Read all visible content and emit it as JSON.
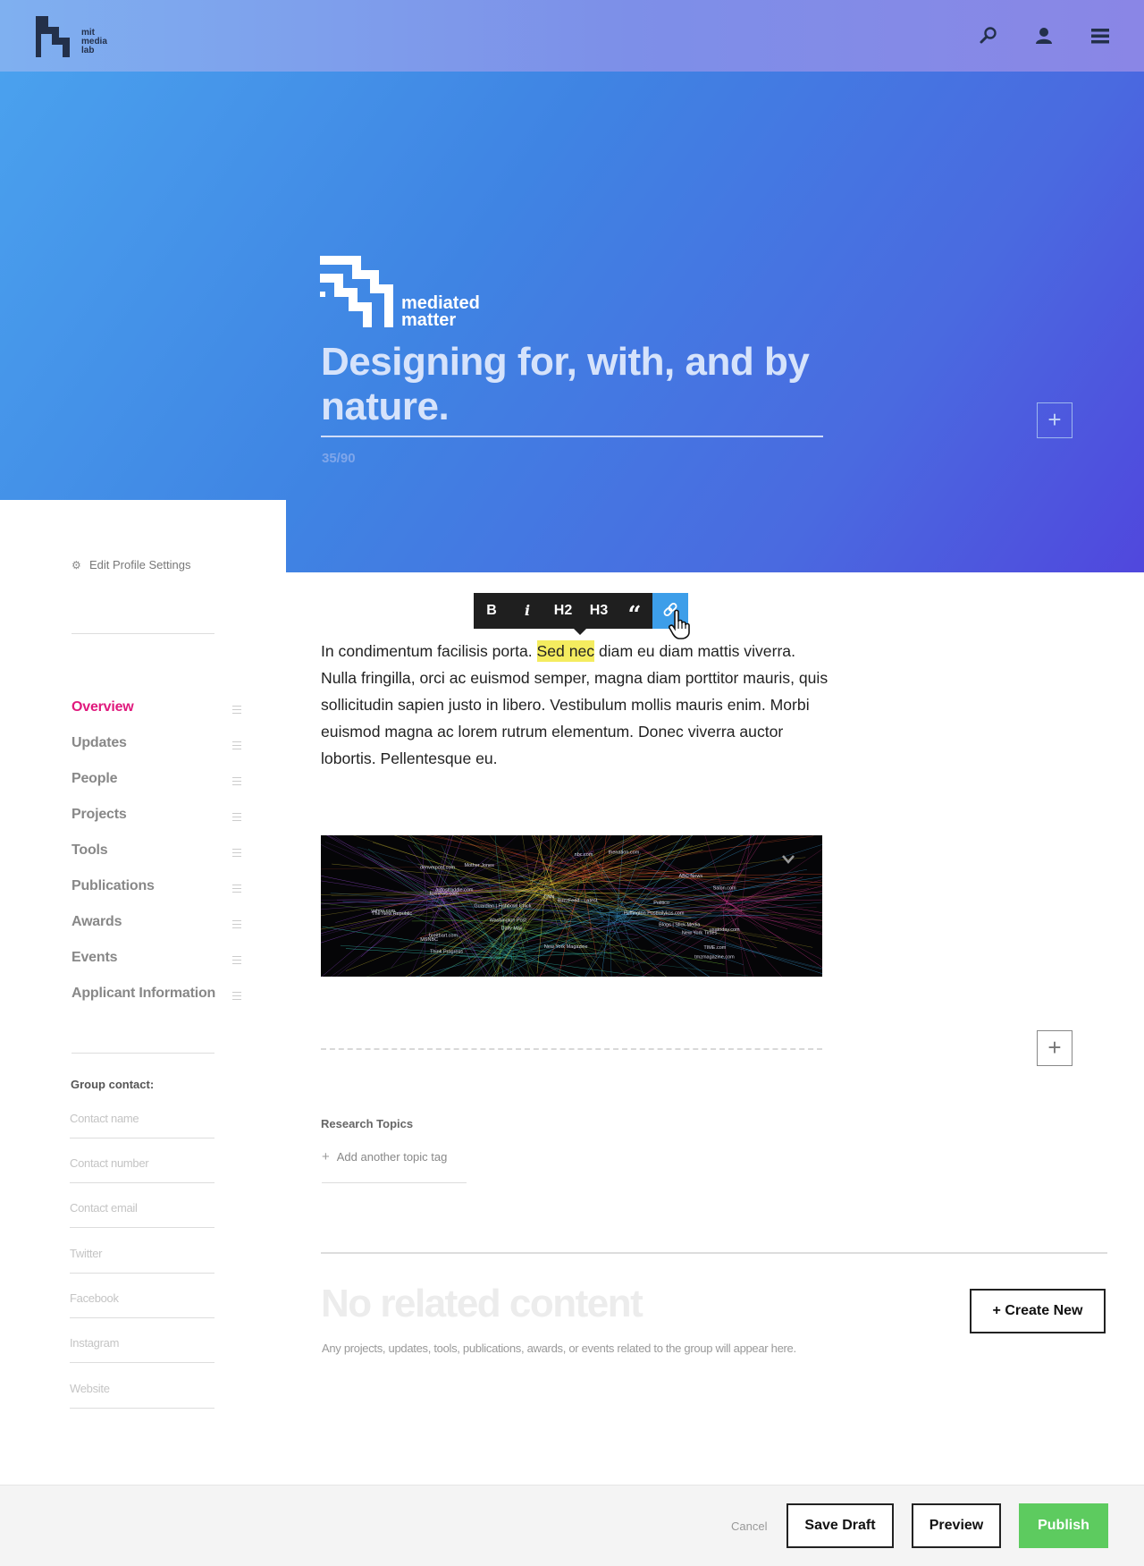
{
  "header": {
    "logo_text": [
      "mit",
      "media",
      "lab"
    ],
    "icons": [
      "search-icon",
      "user-icon",
      "menu-icon"
    ]
  },
  "hero": {
    "group_logo_text": [
      "mediated",
      "matter"
    ],
    "title": "Designing for, with, and by nature.",
    "char_count": "35/90"
  },
  "sidebar": {
    "edit_profile_label": "Edit Profile Settings",
    "nav": [
      {
        "label": "Overview",
        "active": true
      },
      {
        "label": "Updates"
      },
      {
        "label": "People"
      },
      {
        "label": "Projects"
      },
      {
        "label": "Tools"
      },
      {
        "label": "Publications"
      },
      {
        "label": "Awards"
      },
      {
        "label": "Events"
      },
      {
        "label": "Applicant Information"
      }
    ],
    "group_contact_label": "Group contact:",
    "contact_fields": [
      "Contact name",
      "Contact number",
      "Contact email",
      "Twitter",
      "Facebook",
      "Instagram",
      "Website"
    ]
  },
  "editor": {
    "toolbar": [
      "B",
      "i",
      "H2",
      "H3",
      "“",
      "link"
    ],
    "body_before": "In condimentum facilisis porta. ",
    "body_highlight": "Sed nec",
    "body_after": " diam eu diam mattis viverra. Nulla fringilla, orci ac euismod semper, magna diam porttitor mauris, quis sollicitudin sapien justo in libero. Vestibulum mollis mauris enim. Morbi euismod magna ac lorem rutrum elementum. Donec viverra auctor lobortis. Pellentesque eu.",
    "image_labels": [
      "CNN",
      "ABC News",
      "The New Republic",
      "denverpost.com",
      "yahoo.com",
      "Washington Post",
      "TIME.com",
      "Politico",
      "MSNBC",
      "usatoday.com",
      "foxnews.com",
      "Salon.com",
      "nbc.com",
      "Blogs | Slick Media",
      "New York Times",
      "autostraddle.com",
      "dailykos.com",
      "Mother Jones",
      "Think Progress",
      "BuzzFeed - Latest",
      "thenation.com",
      "tmzmagazine.com",
      "Daily Mail",
      "breitbart.com",
      "New York Magazine",
      "Huffington Post",
      "Guardian | Fishbowl Chick"
    ]
  },
  "research": {
    "label": "Research Topics",
    "add_placeholder": "Add another topic tag"
  },
  "related": {
    "title": "No related content",
    "description": "Any projects, updates, tools, publications, awards, or events related to the group will appear here.",
    "create_label": "+ Create New"
  },
  "footer": {
    "cancel": "Cancel",
    "save_draft": "Save Draft",
    "preview": "Preview",
    "publish": "Publish"
  },
  "colors": {
    "accent_pink": "#e0197d",
    "link_blue": "#3d9ee9",
    "publish_green": "#5dcb5f",
    "highlight_yellow": "#f4ec5f"
  }
}
